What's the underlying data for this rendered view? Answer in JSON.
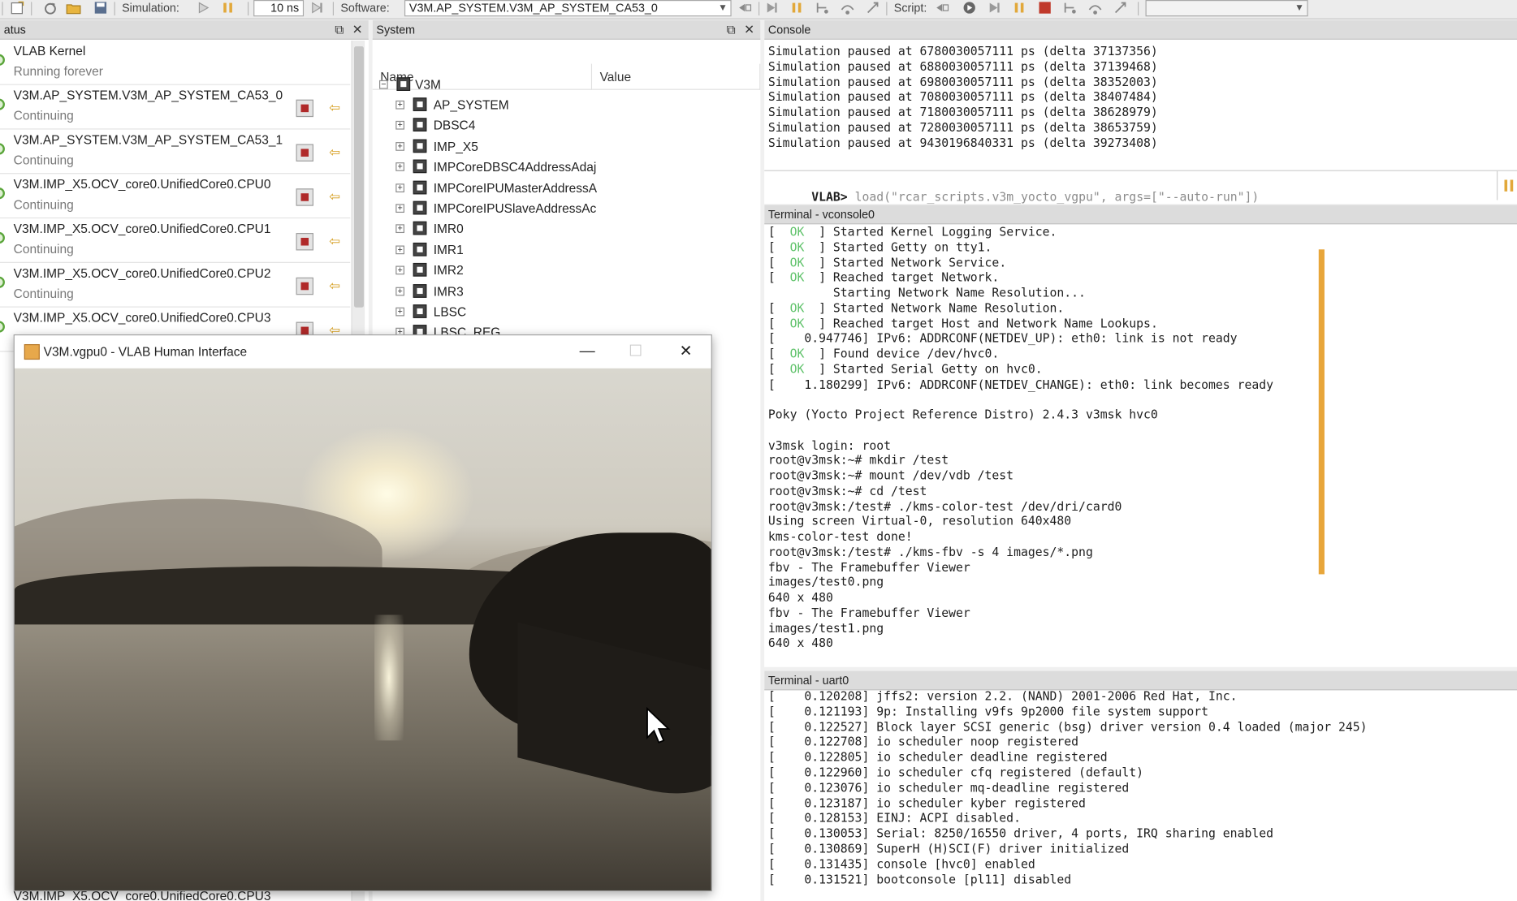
{
  "toolbar": {
    "simulation_label": "Simulation:",
    "step_value": "10 ns",
    "software_label": "Software:",
    "software_value": "V3M.AP_SYSTEM.V3M_AP_SYSTEM_CA53_0",
    "script_label": "Script:",
    "script_value": ""
  },
  "status_panel": {
    "title": "atus",
    "items": [
      {
        "name": "VLAB Kernel",
        "state": "Running forever"
      },
      {
        "name": "V3M.AP_SYSTEM.V3M_AP_SYSTEM_CA53_0",
        "state": "Continuing"
      },
      {
        "name": "V3M.AP_SYSTEM.V3M_AP_SYSTEM_CA53_1",
        "state": "Continuing"
      },
      {
        "name": "V3M.IMP_X5.OCV_core0.UnifiedCore0.CPU0",
        "state": "Continuing"
      },
      {
        "name": "V3M.IMP_X5.OCV_core0.UnifiedCore0.CPU1",
        "state": "Continuing"
      },
      {
        "name": "V3M.IMP_X5.OCV_core0.UnifiedCore0.CPU2",
        "state": "Continuing"
      },
      {
        "name": "V3M.IMP_X5.OCV_core0.UnifiedCore0.CPU3",
        "state": ""
      }
    ],
    "bottom_cut": "V3M.IMP_X5.OCV_core0.UnifiedCore0.CPU3"
  },
  "system_panel": {
    "title": "System",
    "col_name": "Name",
    "col_value": "Value",
    "root": "V3M",
    "items": [
      "AP_SYSTEM",
      "DBSC4",
      "IMP_X5",
      "IMPCoreDBSC4AddressAdaj",
      "IMPCoreIPUMasterAddressA",
      "IMPCoreIPUSlaveAddressAc",
      "IMR0",
      "IMR1",
      "IMR2",
      "IMR3",
      "LBSC",
      "LBSC_REG"
    ]
  },
  "console": {
    "title": "Console",
    "lines": [
      "Simulation paused at 6780030057111 ps (delta 37137356)",
      "Simulation paused at 6880030057111 ps (delta 37139468)",
      "Simulation paused at 6980030057111 ps (delta 38352003)",
      "Simulation paused at 7080030057111 ps (delta 38407484)",
      "Simulation paused at 7180030057111 ps (delta 38628979)",
      "Simulation paused at 7280030057111 ps (delta 38653759)",
      "Simulation paused at 9430196840331 ps (delta 39273408)"
    ],
    "prompt": "VLAB>",
    "input": "load(\"rcar_scripts.v3m_yocto_vgpu\", args=[\"--auto-run\"])"
  },
  "vconsole": {
    "title": "Terminal - vconsole0",
    "lines": [
      {
        "pre": "[  ",
        "ok": "OK",
        "post": "  ] Started Kernel Logging Service."
      },
      {
        "pre": "[  ",
        "ok": "OK",
        "post": "  ] Started Getty on tty1."
      },
      {
        "pre": "[  ",
        "ok": "OK",
        "post": "  ] Started Network Service."
      },
      {
        "pre": "[  ",
        "ok": "OK",
        "post": "  ] Reached target Network."
      },
      {
        "pre": "         Starting Network Name Resolution...",
        "ok": "",
        "post": ""
      },
      {
        "pre": "[  ",
        "ok": "OK",
        "post": "  ] Started Network Name Resolution."
      },
      {
        "pre": "[  ",
        "ok": "OK",
        "post": "  ] Reached target Host and Network Name Lookups."
      },
      {
        "pre": "[    0.947746] IPv6: ADDRCONF(NETDEV_UP): eth0: link is not ready",
        "ok": "",
        "post": ""
      },
      {
        "pre": "[  ",
        "ok": "OK",
        "post": "  ] Found device /dev/hvc0."
      },
      {
        "pre": "[  ",
        "ok": "OK",
        "post": "  ] Started Serial Getty on hvc0."
      },
      {
        "pre": "[    1.180299] IPv6: ADDRCONF(NETDEV_CHANGE): eth0: link becomes ready",
        "ok": "",
        "post": ""
      },
      {
        "pre": "",
        "ok": "",
        "post": ""
      },
      {
        "pre": "Poky (Yocto Project Reference Distro) 2.4.3 v3msk hvc0",
        "ok": "",
        "post": ""
      },
      {
        "pre": "",
        "ok": "",
        "post": ""
      },
      {
        "pre": "v3msk login: root",
        "ok": "",
        "post": ""
      },
      {
        "pre": "root@v3msk:~# mkdir /test",
        "ok": "",
        "post": ""
      },
      {
        "pre": "root@v3msk:~# mount /dev/vdb /test",
        "ok": "",
        "post": ""
      },
      {
        "pre": "root@v3msk:~# cd /test",
        "ok": "",
        "post": ""
      },
      {
        "pre": "root@v3msk:/test# ./kms-color-test /dev/dri/card0",
        "ok": "",
        "post": ""
      },
      {
        "pre": "Using screen Virtual-0, resolution 640x480",
        "ok": "",
        "post": ""
      },
      {
        "pre": "kms-color-test done!",
        "ok": "",
        "post": ""
      },
      {
        "pre": "root@v3msk:/test# ./kms-fbv -s 4 images/*.png",
        "ok": "",
        "post": ""
      },
      {
        "pre": "fbv - The Framebuffer Viewer",
        "ok": "",
        "post": ""
      },
      {
        "pre": "images/test0.png",
        "ok": "",
        "post": ""
      },
      {
        "pre": "640 x 480",
        "ok": "",
        "post": ""
      },
      {
        "pre": "fbv - The Framebuffer Viewer",
        "ok": "",
        "post": ""
      },
      {
        "pre": "images/test1.png",
        "ok": "",
        "post": ""
      },
      {
        "pre": "640 x 480",
        "ok": "",
        "post": ""
      }
    ]
  },
  "uart": {
    "title": "Terminal - uart0",
    "lines": [
      "[    0.120208] jffs2: version 2.2. (NAND) 2001-2006 Red Hat, Inc.",
      "[    0.121193] 9p: Installing v9fs 9p2000 file system support",
      "[    0.122527] Block layer SCSI generic (bsg) driver version 0.4 loaded (major 245)",
      "[    0.122708] io scheduler noop registered",
      "[    0.122805] io scheduler deadline registered",
      "[    0.122960] io scheduler cfq registered (default)",
      "[    0.123076] io scheduler mq-deadline registered",
      "[    0.123187] io scheduler kyber registered",
      "[    0.128153] EINJ: ACPI disabled.",
      "[    0.130053] Serial: 8250/16550 driver, 4 ports, IRQ sharing enabled",
      "[    0.130869] SuperH (H)SCI(F) driver initialized",
      "[    0.131435] console [hvc0] enabled",
      "[    0.131521] bootconsole [pl11] disabled"
    ]
  },
  "hmi_window": {
    "title": "V3M.vgpu0 - VLAB Human Interface",
    "minimize": "—",
    "maximize": "☐",
    "close": "✕"
  },
  "colors": {
    "ok_green": "#5fc26a",
    "accent_orange": "#e8a63a",
    "stop_red": "#b02a2a"
  }
}
